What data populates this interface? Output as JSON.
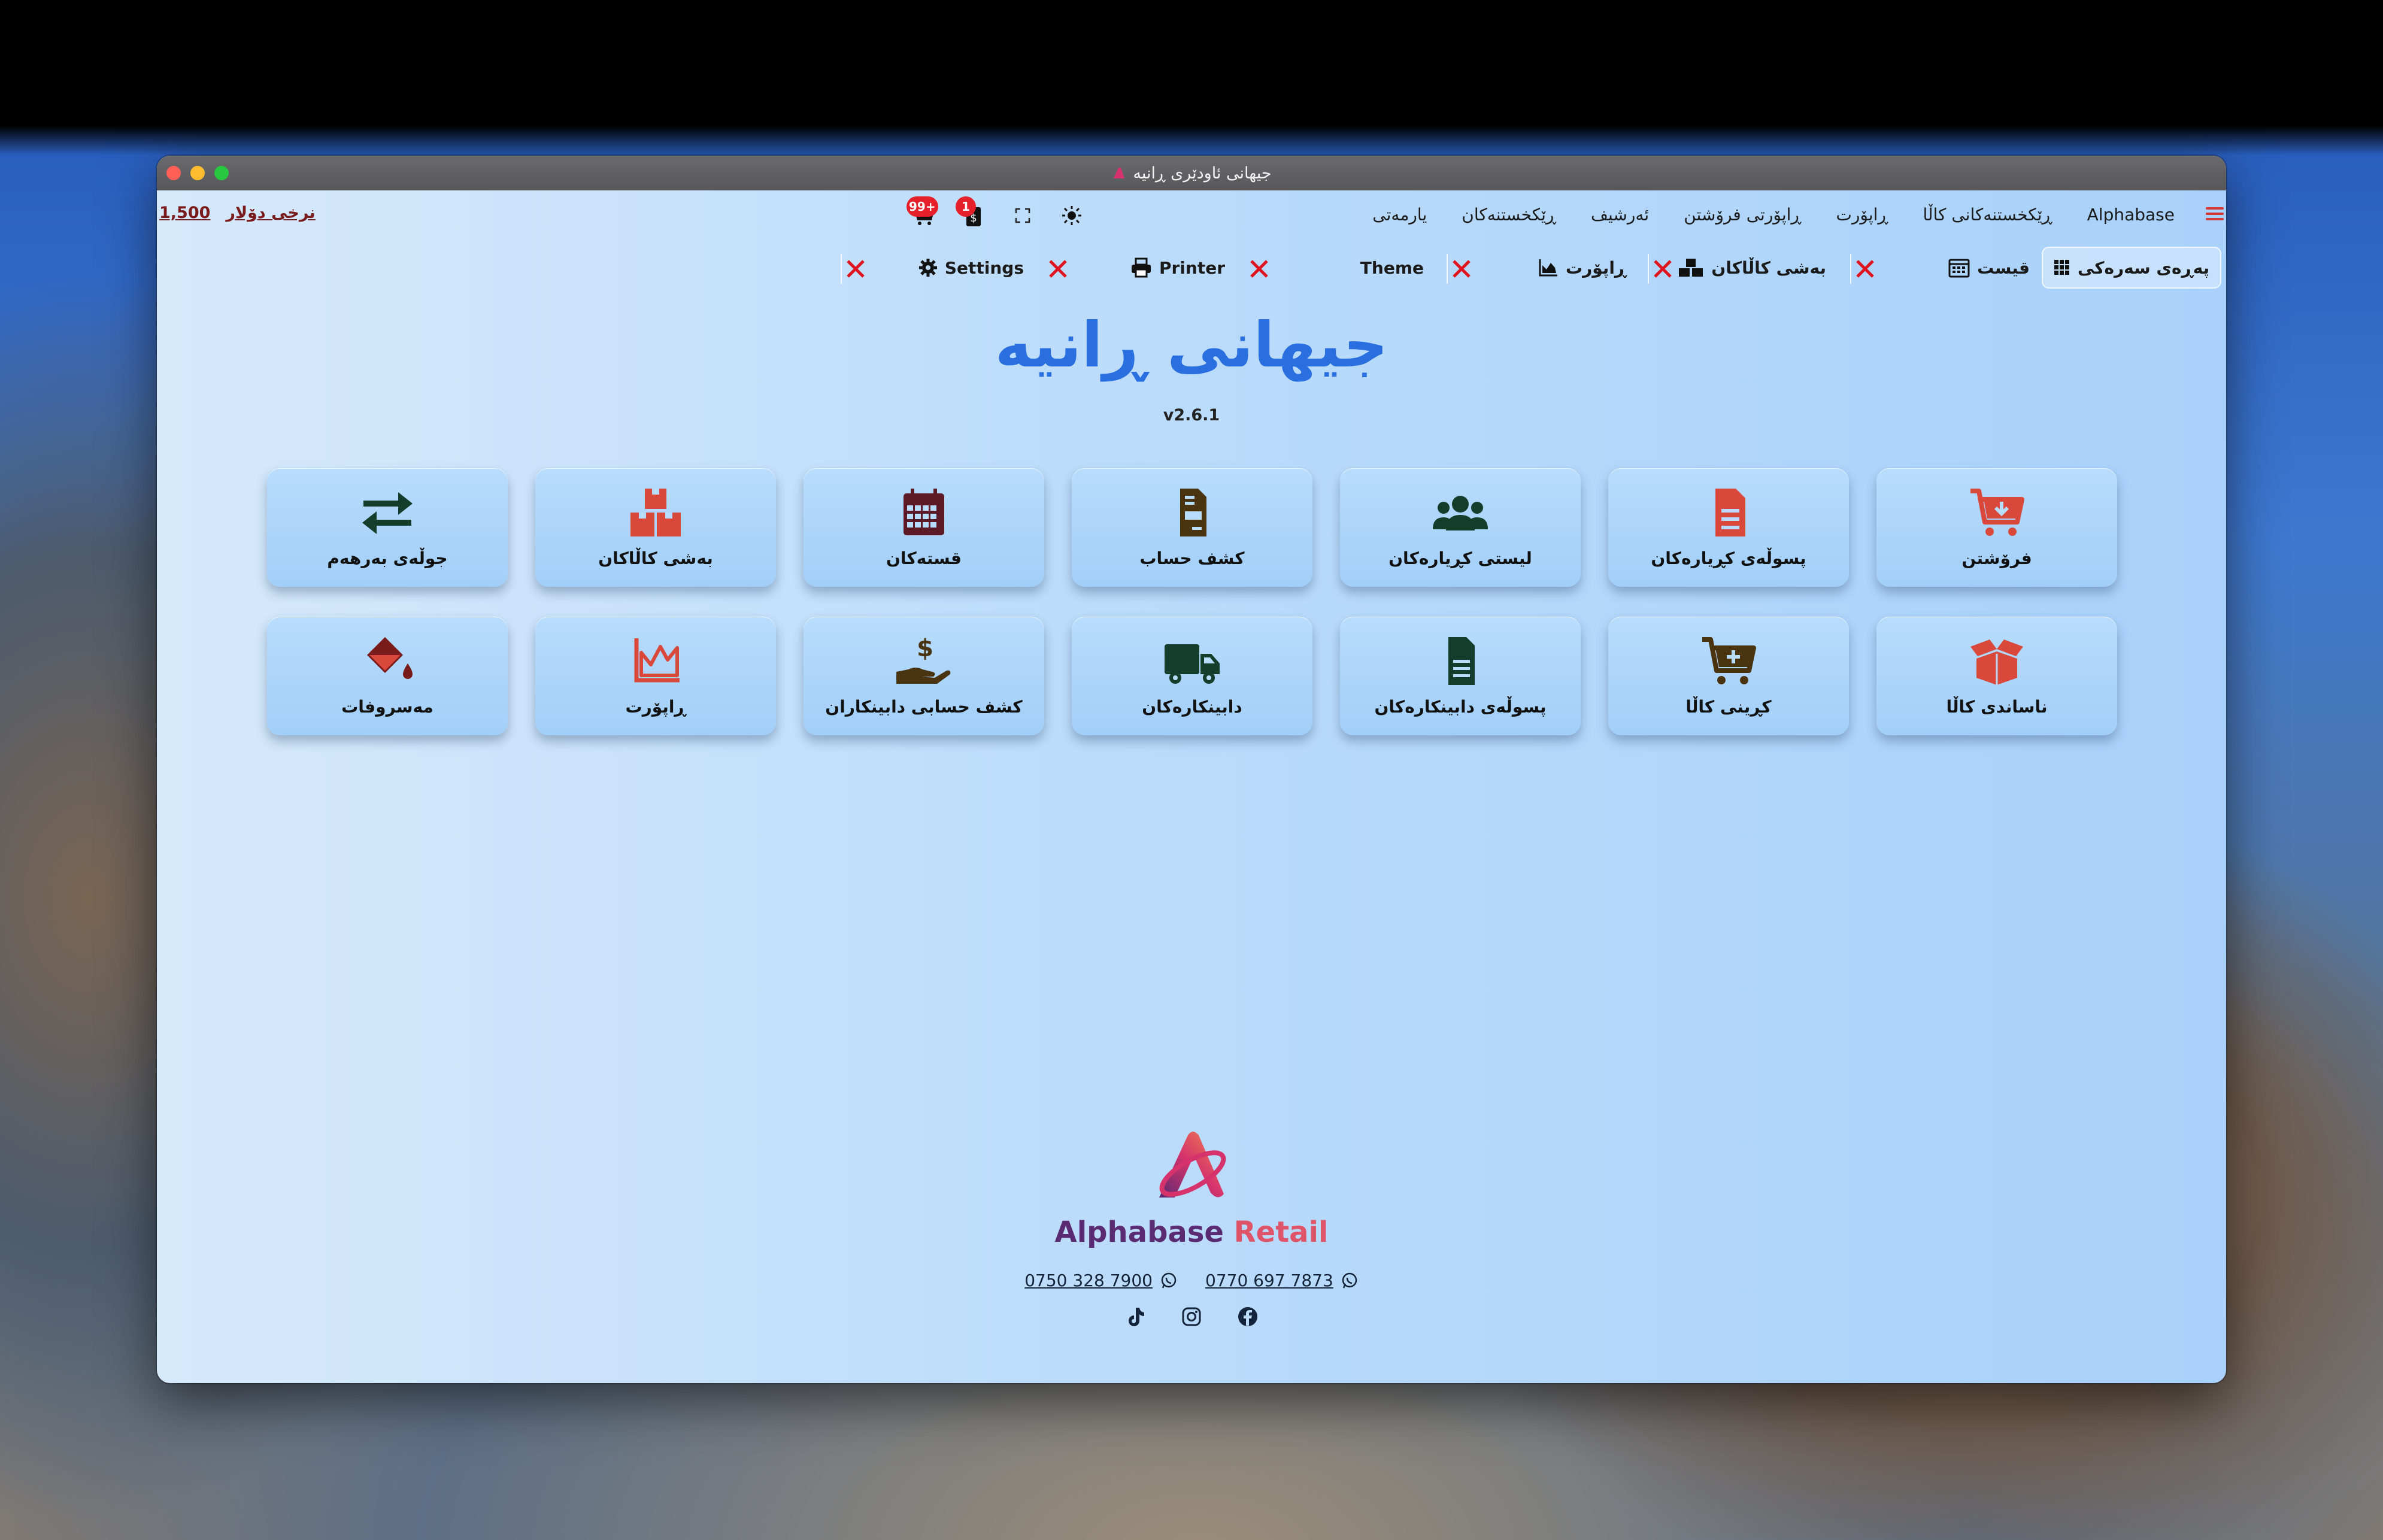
{
  "window": {
    "title": "جیهانی ئاودێری ڕانیە"
  },
  "header": {
    "exchange_rate_label": "نرخی دۆلار",
    "exchange_rate_value": "1,500",
    "badge_cart": "99+",
    "badge_money": "1",
    "menu": [
      "Alphabase",
      "ڕێکخستنەکانی کاڵا",
      "ڕاپۆرت",
      "ڕاپۆرتی فرۆشتن",
      "ئەرشیف",
      "ڕێکخستنەکان",
      "یارمەتی"
    ]
  },
  "tabs": [
    {
      "label": "پەڕەی سەرەکی",
      "icon": "grid-icon",
      "active": true
    },
    {
      "label": "قیست",
      "icon": "calendar-icon"
    },
    {
      "label": "بەشی کاڵاکان",
      "icon": "boxes-icon"
    },
    {
      "label": "ڕاپۆرت",
      "icon": "chart-icon"
    },
    {
      "label": "Theme",
      "icon": ""
    },
    {
      "label": "Printer",
      "icon": "printer-icon"
    },
    {
      "label": "Settings",
      "icon": "gear-icon"
    }
  ],
  "main": {
    "title": "جیهانی  ڕانیە",
    "version": "v2.6.1",
    "cards_row1": [
      {
        "label": "فرۆشتن",
        "icon": "cart-download-icon",
        "color": "#d9483b"
      },
      {
        "label": "پسوڵەی کڕیارەکان",
        "icon": "invoice-icon",
        "color": "#d9483b"
      },
      {
        "label": "لیستی کڕیارەکان",
        "icon": "users-icon",
        "color": "#153d2c"
      },
      {
        "label": "کشف حساب",
        "icon": "file-invoice-icon",
        "color": "#4a3410"
      },
      {
        "label": "قستەکان",
        "icon": "calendar-icon",
        "color": "#5c1a26"
      },
      {
        "label": "بەشی کاڵاکان",
        "icon": "boxes-icon",
        "color": "#d9483b"
      },
      {
        "label": "جوڵەی بەرهەم",
        "icon": "exchange-icon",
        "color": "#153d2c"
      }
    ],
    "cards_row2": [
      {
        "label": "ناساندی کاڵا",
        "icon": "box-open-icon",
        "color": "#d9483b"
      },
      {
        "label": "کڕینی کاڵا",
        "icon": "cart-plus-icon",
        "color": "#4a3410"
      },
      {
        "label": "پسوڵەی دابینکارەکان",
        "icon": "document-icon",
        "color": "#153d2c"
      },
      {
        "label": "دابینکارەکان",
        "icon": "truck-icon",
        "color": "#153d2c"
      },
      {
        "label": "کشف حسابی دابینکاران",
        "icon": "hand-dollar-icon",
        "color": "#4a3410"
      },
      {
        "label": "ڕاپۆرت",
        "icon": "chart-icon",
        "color": "#d9483b"
      },
      {
        "label": "مەسروفات",
        "icon": "fill-drip-icon",
        "color": "#7a1b1b"
      }
    ]
  },
  "footer": {
    "brand_part1": "Alphabase",
    "brand_part2": "Retail",
    "phone1": "0770 697 7873",
    "phone2": "0750 328 7900"
  }
}
